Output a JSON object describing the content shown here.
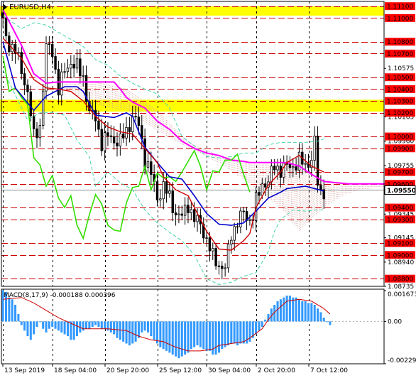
{
  "window": {
    "symbol_title": "EURUSD,H4"
  },
  "colors": {
    "background": "#ffffff",
    "candle": "#000000",
    "level_line": "#cc0000",
    "highlight_band": "#ffff00",
    "price_tag_bg": "#ff0000",
    "price_tag_text": "#ffffff",
    "current_price_tag_bg": "#ffffff",
    "tenkan": "#cc0000",
    "kijun": "#0000cc",
    "chikou": "#33dd00",
    "senkou_b": "#ff00ff",
    "bollinger": "#44d4aa",
    "kumo": "#d9a0a0",
    "macd_hist": "#3399ff",
    "macd_signal": "#cc0000"
  },
  "chart_data": {
    "type": "candlestick",
    "symbol": "EURUSD",
    "timeframe": "H4",
    "ylim": [
      1.08735,
      1.1114
    ],
    "y_ticks": [
      "1.10575",
      "1.10165",
      "1.09755",
      "1.09345",
      "1.09145",
      "1.08940",
      "1.08735",
      "1.09960"
    ],
    "x_tick_labels": [
      "13 Sep 2019",
      "18 Sep 04:00",
      "20 Sep 20:00",
      "25 Sep 12:00",
      "30 Sep 04:00",
      "2 Oct 20:00",
      "7 Oct 12:00"
    ],
    "x_tick_positions": [
      0,
      16,
      33,
      50,
      66,
      82,
      99
    ],
    "num_bars": 124,
    "levels": [
      "1.11100",
      "1.11000",
      "1.10800",
      "1.10700",
      "1.10500",
      "1.10400",
      "1.10300",
      "1.10200",
      "1.10000",
      "1.09900",
      "1.09700",
      "1.09600",
      "1.09400",
      "1.09300",
      "1.09100",
      "1.09000",
      "1.08800"
    ],
    "current_price": "1.09550",
    "highlight_zones": [
      [
        1.1102,
        1.111
      ],
      [
        1.1021,
        1.1031
      ]
    ],
    "close_path": [
      [
        0,
        1.1097
      ],
      [
        1,
        1.1082
      ],
      [
        2,
        1.1078
      ],
      [
        3,
        1.1076
      ],
      [
        4,
        1.1073
      ],
      [
        6,
        1.1055
      ],
      [
        8,
        1.1038
      ],
      [
        10,
        1.0999
      ],
      [
        12,
        1.1009
      ],
      [
        14,
        1.1075
      ],
      [
        16,
        1.1072
      ],
      [
        18,
        1.104
      ],
      [
        20,
        1.1055
      ],
      [
        22,
        1.1063
      ],
      [
        24,
        1.1058
      ],
      [
        26,
        1.105
      ],
      [
        28,
        1.102
      ],
      [
        30,
        1.1015
      ],
      [
        32,
        1.0995
      ],
      [
        34,
        1.1
      ],
      [
        36,
        1.0997
      ],
      [
        38,
        1.0996
      ],
      [
        40,
        1.1004
      ],
      [
        42,
        1.1017
      ],
      [
        44,
        1.1009
      ],
      [
        46,
        1.0982
      ],
      [
        48,
        1.0968
      ],
      [
        50,
        1.0948
      ],
      [
        52,
        1.0958
      ],
      [
        54,
        1.0948
      ],
      [
        56,
        1.0935
      ],
      [
        58,
        1.0932
      ],
      [
        60,
        1.0943
      ],
      [
        62,
        1.093
      ],
      [
        64,
        1.0926
      ],
      [
        66,
        1.0913
      ],
      [
        68,
        1.0898
      ],
      [
        70,
        1.0892
      ],
      [
        72,
        1.0888
      ],
      [
        74,
        1.0918
      ],
      [
        76,
        1.0928
      ],
      [
        78,
        1.0935
      ],
      [
        80,
        1.093
      ],
      [
        81,
        1.0933
      ],
      [
        82,
        1.0945
      ],
      [
        84,
        1.096
      ],
      [
        86,
        1.0962
      ],
      [
        88,
        1.0975
      ],
      [
        90,
        1.0972
      ],
      [
        92,
        1.0974
      ],
      [
        94,
        1.0975
      ],
      [
        96,
        1.098
      ],
      [
        98,
        1.0975
      ],
      [
        100,
        1.0982
      ],
      [
        101,
        1.0995
      ],
      [
        102,
        1.096
      ],
      [
        103,
        1.0952
      ],
      [
        104,
        1.0955
      ]
    ],
    "indicators": {
      "tenkan": [
        [
          0,
          1.1083
        ],
        [
          6,
          1.1066
        ],
        [
          10,
          1.1048
        ],
        [
          14,
          1.1041
        ],
        [
          18,
          1.104
        ],
        [
          22,
          1.1038
        ],
        [
          26,
          1.103
        ],
        [
          30,
          1.1017
        ],
        [
          34,
          1.1008
        ],
        [
          38,
          1.1004
        ],
        [
          42,
          1.1002
        ],
        [
          46,
          1.099
        ],
        [
          50,
          1.0978
        ],
        [
          52,
          1.0966
        ],
        [
          56,
          1.0955
        ],
        [
          60,
          1.095
        ],
        [
          62,
          1.094
        ],
        [
          66,
          1.092
        ],
        [
          70,
          1.0905
        ],
        [
          74,
          1.0904
        ],
        [
          78,
          1.0912
        ],
        [
          80,
          1.0918
        ],
        [
          82,
          1.094
        ],
        [
          86,
          1.0959
        ],
        [
          90,
          1.097
        ],
        [
          92,
          1.0978
        ],
        [
          96,
          1.0984
        ],
        [
          100,
          1.0975
        ],
        [
          104,
          1.097
        ]
      ],
      "kijun": [
        [
          0,
          1.108
        ],
        [
          4,
          1.1041
        ],
        [
          10,
          1.1022
        ],
        [
          14,
          1.1034
        ],
        [
          20,
          1.1042
        ],
        [
          24,
          1.1042
        ],
        [
          26,
          1.1038
        ],
        [
          30,
          1.1018
        ],
        [
          36,
          1.1016
        ],
        [
          40,
          1.102
        ],
        [
          42,
          1.1017
        ],
        [
          46,
          1.0991
        ],
        [
          50,
          1.0978
        ],
        [
          54,
          1.0966
        ],
        [
          58,
          1.0964
        ],
        [
          62,
          1.095
        ],
        [
          66,
          1.0935
        ],
        [
          70,
          1.0926
        ],
        [
          74,
          1.0925
        ],
        [
          78,
          1.0927
        ],
        [
          82,
          1.0937
        ],
        [
          86,
          1.0948
        ],
        [
          90,
          1.0953
        ],
        [
          92,
          1.0956
        ],
        [
          98,
          1.0958
        ],
        [
          104,
          1.0954
        ]
      ],
      "senkou_b": [
        [
          0,
          1.1107
        ],
        [
          6,
          1.1077
        ],
        [
          10,
          1.1053
        ],
        [
          14,
          1.1045
        ],
        [
          18,
          1.1046
        ],
        [
          20,
          1.1046
        ],
        [
          34,
          1.1046
        ],
        [
          36,
          1.1046
        ],
        [
          38,
          1.104
        ],
        [
          40,
          1.1033
        ],
        [
          42,
          1.1029
        ],
        [
          46,
          1.1024
        ],
        [
          50,
          1.1013
        ],
        [
          54,
          1.1006
        ],
        [
          58,
          1.0996
        ],
        [
          62,
          1.099
        ],
        [
          66,
          1.0986
        ],
        [
          70,
          1.0984
        ],
        [
          74,
          1.098
        ],
        [
          78,
          1.0979
        ],
        [
          80,
          1.0978
        ],
        [
          84,
          1.0978
        ],
        [
          88,
          1.0978
        ],
        [
          92,
          1.0978
        ],
        [
          96,
          1.0975
        ],
        [
          100,
          1.0968
        ],
        [
          104,
          1.0962
        ],
        [
          108,
          1.0961
        ],
        [
          112,
          1.096
        ],
        [
          116,
          1.096
        ],
        [
          120,
          1.096
        ],
        [
          124,
          1.096
        ]
      ],
      "chikou": [
        [
          0,
          1.1068
        ],
        [
          2,
          1.1038
        ],
        [
          4,
          1.1041
        ],
        [
          6,
          1.1033
        ],
        [
          8,
          1.1027
        ],
        [
          10,
          1.0982
        ],
        [
          12,
          1.0976
        ],
        [
          14,
          1.0958
        ],
        [
          16,
          1.0967
        ],
        [
          18,
          1.0948
        ],
        [
          20,
          1.094
        ],
        [
          22,
          1.095
        ],
        [
          24,
          1.0925
        ],
        [
          26,
          1.0914
        ],
        [
          28,
          1.0934
        ],
        [
          30,
          1.0951
        ],
        [
          32,
          1.0943
        ],
        [
          34,
          1.0925
        ],
        [
          36,
          1.0921
        ],
        [
          38,
          1.092
        ],
        [
          40,
          1.0944
        ],
        [
          42,
          1.0957
        ],
        [
          44,
          1.0958
        ],
        [
          46,
          1.0975
        ],
        [
          48,
          1.0955
        ],
        [
          50,
          1.0969
        ],
        [
          52,
          1.0965
        ],
        [
          54,
          1.0966
        ],
        [
          56,
          1.0962
        ],
        [
          58,
          1.097
        ],
        [
          60,
          1.0979
        ],
        [
          62,
          1.0988
        ],
        [
          64,
          1.0975
        ],
        [
          66,
          1.0955
        ],
        [
          68,
          1.0971
        ],
        [
          70,
          1.097
        ],
        [
          72,
          1.098
        ],
        [
          74,
          1.098
        ],
        [
          76,
          1.0985
        ],
        [
          78,
          1.0968
        ],
        [
          80,
          1.0953
        ]
      ],
      "bollinger_upper": [
        [
          0,
          1.1102
        ],
        [
          6,
          1.1091
        ],
        [
          10,
          1.1096
        ],
        [
          14,
          1.1094
        ],
        [
          18,
          1.1088
        ],
        [
          22,
          1.1082
        ],
        [
          26,
          1.1076
        ],
        [
          30,
          1.1065
        ],
        [
          34,
          1.106
        ],
        [
          38,
          1.1051
        ],
        [
          42,
          1.1045
        ],
        [
          46,
          1.104
        ],
        [
          50,
          1.1036
        ],
        [
          54,
          1.1024
        ],
        [
          58,
          1.1
        ],
        [
          62,
          1.0992
        ],
        [
          66,
          1.0983
        ],
        [
          70,
          1.0982
        ],
        [
          74,
          1.0983
        ],
        [
          78,
          1.0986
        ],
        [
          82,
          1.0986
        ],
        [
          86,
          1.0993
        ],
        [
          90,
          1.0995
        ],
        [
          94,
          1.0995
        ],
        [
          98,
          1.0995
        ],
        [
          102,
          1.0996
        ],
        [
          104,
          1.0998
        ]
      ],
      "bollinger_lower": [
        [
          0,
          1.1056
        ],
        [
          4,
          1.1035
        ],
        [
          8,
          1.1014
        ],
        [
          12,
          1.102
        ],
        [
          16,
          1.102
        ],
        [
          20,
          1.1018
        ],
        [
          24,
          1.0997
        ],
        [
          28,
          1.0983
        ],
        [
          30,
          1.0958
        ],
        [
          34,
          1.097
        ],
        [
          38,
          1.0961
        ],
        [
          42,
          1.0955
        ],
        [
          46,
          1.0938
        ],
        [
          50,
          1.0927
        ],
        [
          54,
          1.0919
        ],
        [
          58,
          1.0912
        ],
        [
          62,
          1.09
        ],
        [
          66,
          1.088
        ],
        [
          70,
          1.0875
        ],
        [
          74,
          1.0877
        ],
        [
          78,
          1.0882
        ],
        [
          82,
          1.0885
        ],
        [
          86,
          1.0903
        ],
        [
          88,
          1.092
        ],
        [
          90,
          1.093
        ],
        [
          94,
          1.0938
        ],
        [
          98,
          1.0937
        ],
        [
          102,
          1.0938
        ],
        [
          104,
          1.0938
        ]
      ],
      "kumo_fill": [
        [
          20,
          1.104,
          1.1046
        ],
        [
          30,
          1.1026,
          1.1046
        ],
        [
          40,
          1.1022,
          1.104
        ],
        [
          50,
          1.1005,
          1.1022
        ],
        [
          60,
          1.099,
          1.0995
        ],
        [
          70,
          1.0978,
          1.0984
        ],
        [
          80,
          1.096,
          1.0978
        ],
        [
          90,
          1.094,
          1.0978
        ],
        [
          96,
          1.092,
          1.0975
        ],
        [
          100,
          1.093,
          1.0968
        ],
        [
          104,
          1.094,
          1.0962
        ],
        [
          110,
          1.095,
          1.096
        ],
        [
          116,
          1.0955,
          1.096
        ],
        [
          124,
          1.0958,
          1.096
        ]
      ]
    },
    "macd": {
      "label": "MACD(8,17,9) -0.000188 0.000396",
      "y_ticks": [
        "0.001673",
        "0.00",
        "-0.002297"
      ],
      "ylim": [
        -0.0023,
        0.00175
      ],
      "histogram": [
        0.0017,
        0.0016,
        0.0013,
        0.0012,
        0.0009,
        0.0004,
        -0.0002,
        -0.0005,
        -0.0008,
        -0.001,
        -0.0007,
        -0.0003,
        0.0,
        -0.0004,
        -0.0006,
        -0.0004,
        -0.0003,
        -0.0004,
        -0.0005,
        -0.0006,
        -0.0007,
        -0.0008,
        -0.001,
        -0.001,
        -0.0008,
        -0.0006,
        -0.0005,
        -0.0004,
        -0.0004,
        -0.0003,
        -0.0002,
        -0.0003,
        -0.0004,
        -0.0004,
        -0.0005,
        -0.0006,
        -0.0007,
        -0.0009,
        -0.001,
        -0.0011,
        -0.0012,
        -0.0013,
        -0.0012,
        -0.0011,
        -0.0009,
        -0.0006,
        -0.0005,
        -0.0006,
        -0.0008,
        -0.001,
        -0.0012,
        -0.0014,
        -0.0015,
        -0.0016,
        -0.0017,
        -0.0018,
        -0.0019,
        -0.002,
        -0.0019,
        -0.0018,
        -0.0017,
        -0.0015,
        -0.0014,
        -0.0013,
        -0.0014,
        -0.0015,
        -0.0016,
        -0.0016,
        -0.0018,
        -0.0018,
        -0.0017,
        -0.0015,
        -0.0014,
        -0.0013,
        -0.0012,
        -0.0012,
        -0.0013,
        -0.0012,
        -0.0012,
        -0.0012,
        -0.0011,
        -0.0009,
        -0.0007,
        -0.0005,
        -0.0003,
        0.0001,
        0.0004,
        0.0007,
        0.0009,
        0.0011,
        0.0012,
        0.0013,
        0.0014,
        0.0014,
        0.0013,
        0.0013,
        0.0012,
        0.0011,
        0.0011,
        0.001,
        0.001,
        0.0009,
        0.0007,
        0.0005,
        0.0002,
        0.0,
        -0.0002
      ],
      "signal": [
        [
          0,
          0.0012
        ],
        [
          6,
          0.0013
        ],
        [
          10,
          0.001
        ],
        [
          14,
          0.0006
        ],
        [
          18,
          0.0002
        ],
        [
          22,
          -0.0001
        ],
        [
          26,
          -0.0004
        ],
        [
          30,
          -0.0004
        ],
        [
          34,
          -0.0004
        ],
        [
          40,
          -0.0005
        ],
        [
          44,
          -0.0008
        ],
        [
          48,
          -0.001
        ],
        [
          52,
          -0.0011
        ],
        [
          56,
          -0.0014
        ],
        [
          60,
          -0.0016
        ],
        [
          64,
          -0.0016
        ],
        [
          68,
          -0.0015
        ],
        [
          70,
          -0.0013
        ],
        [
          74,
          -0.0012
        ],
        [
          78,
          -0.0011
        ],
        [
          80,
          -0.0009
        ],
        [
          84,
          -0.0004
        ],
        [
          86,
          0.0001
        ],
        [
          88,
          0.0005
        ],
        [
          92,
          0.0011
        ],
        [
          96,
          0.0012
        ],
        [
          100,
          0.0011
        ],
        [
          104,
          0.0007
        ],
        [
          106,
          0.0004
        ]
      ]
    }
  }
}
